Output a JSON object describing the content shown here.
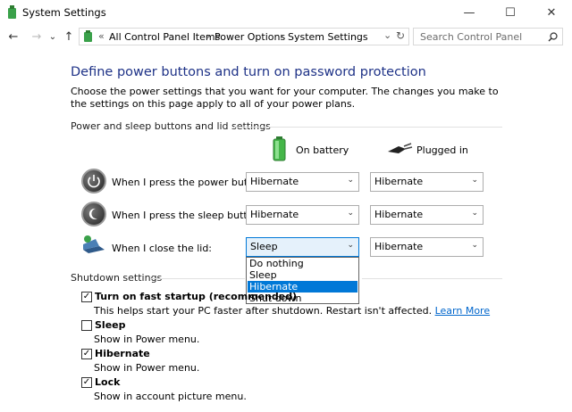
{
  "window": {
    "title": "System Settings",
    "minimize": "—",
    "maximize": "☐",
    "close": "✕"
  },
  "nav": {
    "back": "←",
    "forward": "→",
    "recent": "⌄",
    "up": "↑",
    "breadcrumb": [
      "All Control Panel Items",
      "Power Options",
      "System Settings"
    ],
    "sep": "›",
    "prefix": "«",
    "address_dropdown": "⌄",
    "refresh": "↻",
    "search_placeholder": "Search Control Panel"
  },
  "page": {
    "heading": "Define power buttons and turn on password protection",
    "description": "Choose the power settings that you want for your computer. The changes you make to the settings on this page apply to all of your power plans."
  },
  "power_section": {
    "title": "Power and sleep buttons and lid settings",
    "col_battery": "On battery",
    "col_plugged": "Plugged in",
    "rows": [
      {
        "label": "When I press the power button:",
        "battery": "Hibernate",
        "plugged": "Hibernate"
      },
      {
        "label": "When I press the sleep button:",
        "battery": "Hibernate",
        "plugged": "Hibernate"
      },
      {
        "label": "When I close the lid:",
        "battery": "Sleep",
        "plugged": "Hibernate"
      }
    ],
    "dropdown_options": [
      "Do nothing",
      "Sleep",
      "Hibernate",
      "Shut down"
    ],
    "dropdown_highlighted": "Hibernate"
  },
  "shutdown_section": {
    "title": "Shutdown settings",
    "items": [
      {
        "label": "Turn on fast startup (recommended)",
        "checked": true,
        "desc": "This helps start your PC faster after shutdown. Restart isn't affected.",
        "link": "Learn More"
      },
      {
        "label": "Sleep",
        "checked": false,
        "desc": "Show in Power menu."
      },
      {
        "label": "Hibernate",
        "checked": true,
        "desc": "Show in Power menu."
      },
      {
        "label": "Lock",
        "checked": true,
        "desc": "Show in account picture menu."
      }
    ]
  },
  "checkmark": "✓",
  "chevron": "⌄",
  "colors": {
    "heading": "#1e3287",
    "link": "#0066cc",
    "highlight": "#0078d7"
  }
}
